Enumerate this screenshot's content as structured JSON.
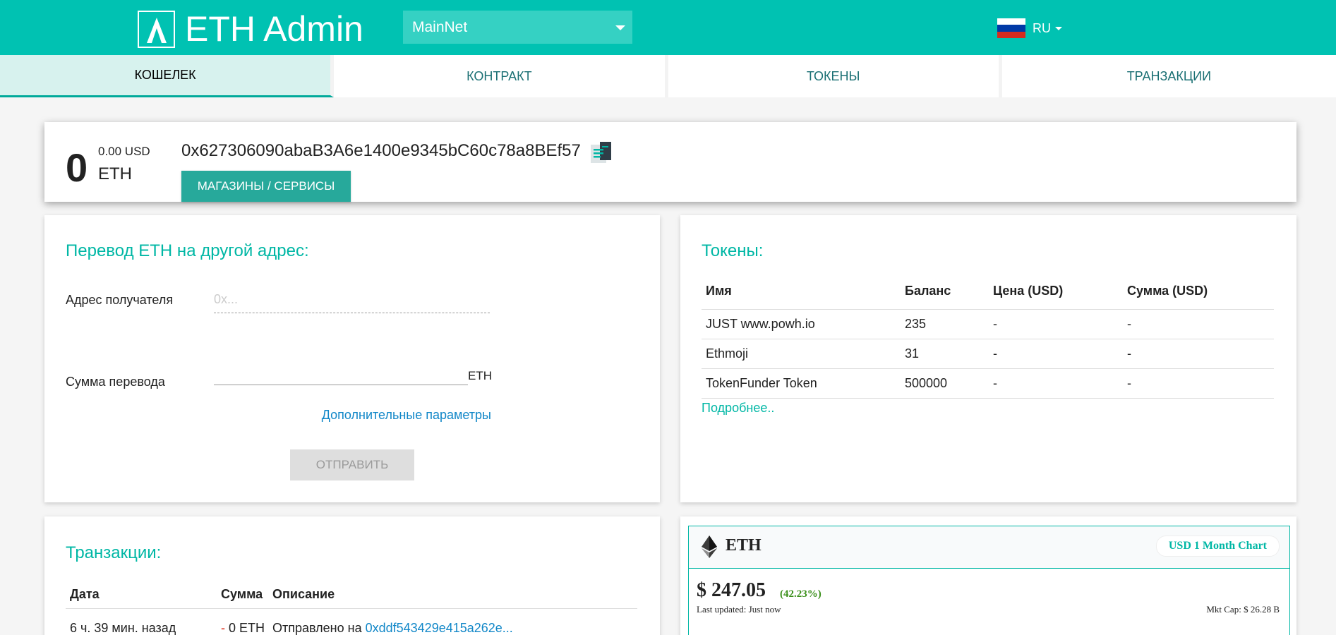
{
  "header": {
    "app_title": "ETH Admin",
    "network": "MainNet",
    "language": "RU",
    "brand_color": "#00c2b2"
  },
  "tabs": [
    {
      "label": "КОШЕЛЕК",
      "active": true
    },
    {
      "label": "КОНТРАКТ",
      "active": false
    },
    {
      "label": "ТОКЕНЫ",
      "active": false
    },
    {
      "label": "ТРАНЗАКЦИИ",
      "active": false
    }
  ],
  "wallet": {
    "balance": "0",
    "balance_usd": "0.00 USD",
    "unit": "ETH",
    "address": "0x627306090abaB3A6e1400e9345bC60c78a8BEf57",
    "shops_button": "МАГАЗИНЫ / СЕРВИСЫ"
  },
  "transfer": {
    "title": "Перевод ETH на другой адрес:",
    "recipient_label": "Адрес получателя",
    "recipient_placeholder": "0x...",
    "amount_label": "Сумма перевода",
    "amount_unit": "ETH",
    "advanced_link": "Дополнительные параметры",
    "send_button": "ОТПРАВИТЬ"
  },
  "tokens": {
    "title": "Токены:",
    "columns": [
      "Имя",
      "Баланс",
      "Цена (USD)",
      "Сумма (USD)"
    ],
    "rows": [
      [
        "JUST www.powh.io",
        "235",
        "-",
        "-"
      ],
      [
        "Ethmoji",
        "31",
        "-",
        "-"
      ],
      [
        "TokenFunder Token",
        "500000",
        "-",
        "-"
      ]
    ],
    "more_link": "Подробнее.."
  },
  "transactions": {
    "title": "Транзакции:",
    "columns": [
      "Дата",
      "Сумма",
      "Описание"
    ],
    "rows": [
      {
        "date": "6 ч. 39 мин. назад",
        "sign": "-",
        "amount": "0 ETH",
        "desc_prefix": "Отправлено на",
        "desc_link": "0xddf543429e415a262e..."
      }
    ]
  },
  "price_widget": {
    "symbol": "ETH",
    "chart_button": "USD 1 Month Chart",
    "price": "$ 247.05",
    "change": "(42.23%)",
    "updated": "Last updated: Just now",
    "market_cap": "Mkt Cap: $ 26.28 B"
  }
}
